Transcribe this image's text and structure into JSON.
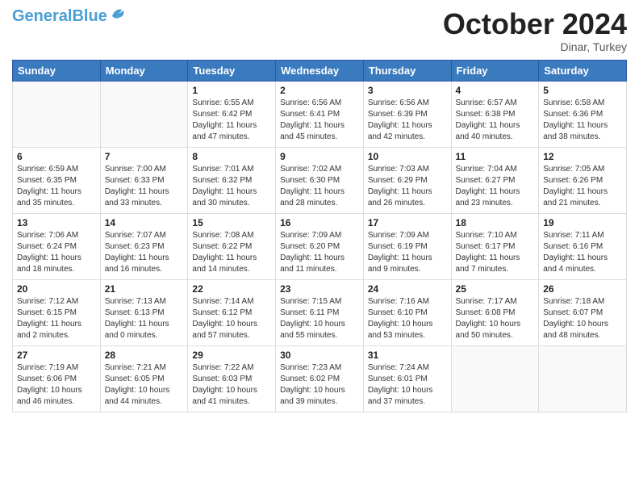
{
  "header": {
    "logo_general": "General",
    "logo_blue": "Blue",
    "month_title": "October 2024",
    "subtitle": "Dinar, Turkey"
  },
  "weekdays": [
    "Sunday",
    "Monday",
    "Tuesday",
    "Wednesday",
    "Thursday",
    "Friday",
    "Saturday"
  ],
  "weeks": [
    [
      {
        "day": "",
        "sunrise": "",
        "sunset": "",
        "daylight": ""
      },
      {
        "day": "",
        "sunrise": "",
        "sunset": "",
        "daylight": ""
      },
      {
        "day": "1",
        "sunrise": "Sunrise: 6:55 AM",
        "sunset": "Sunset: 6:42 PM",
        "daylight": "Daylight: 11 hours and 47 minutes."
      },
      {
        "day": "2",
        "sunrise": "Sunrise: 6:56 AM",
        "sunset": "Sunset: 6:41 PM",
        "daylight": "Daylight: 11 hours and 45 minutes."
      },
      {
        "day": "3",
        "sunrise": "Sunrise: 6:56 AM",
        "sunset": "Sunset: 6:39 PM",
        "daylight": "Daylight: 11 hours and 42 minutes."
      },
      {
        "day": "4",
        "sunrise": "Sunrise: 6:57 AM",
        "sunset": "Sunset: 6:38 PM",
        "daylight": "Daylight: 11 hours and 40 minutes."
      },
      {
        "day": "5",
        "sunrise": "Sunrise: 6:58 AM",
        "sunset": "Sunset: 6:36 PM",
        "daylight": "Daylight: 11 hours and 38 minutes."
      }
    ],
    [
      {
        "day": "6",
        "sunrise": "Sunrise: 6:59 AM",
        "sunset": "Sunset: 6:35 PM",
        "daylight": "Daylight: 11 hours and 35 minutes."
      },
      {
        "day": "7",
        "sunrise": "Sunrise: 7:00 AM",
        "sunset": "Sunset: 6:33 PM",
        "daylight": "Daylight: 11 hours and 33 minutes."
      },
      {
        "day": "8",
        "sunrise": "Sunrise: 7:01 AM",
        "sunset": "Sunset: 6:32 PM",
        "daylight": "Daylight: 11 hours and 30 minutes."
      },
      {
        "day": "9",
        "sunrise": "Sunrise: 7:02 AM",
        "sunset": "Sunset: 6:30 PM",
        "daylight": "Daylight: 11 hours and 28 minutes."
      },
      {
        "day": "10",
        "sunrise": "Sunrise: 7:03 AM",
        "sunset": "Sunset: 6:29 PM",
        "daylight": "Daylight: 11 hours and 26 minutes."
      },
      {
        "day": "11",
        "sunrise": "Sunrise: 7:04 AM",
        "sunset": "Sunset: 6:27 PM",
        "daylight": "Daylight: 11 hours and 23 minutes."
      },
      {
        "day": "12",
        "sunrise": "Sunrise: 7:05 AM",
        "sunset": "Sunset: 6:26 PM",
        "daylight": "Daylight: 11 hours and 21 minutes."
      }
    ],
    [
      {
        "day": "13",
        "sunrise": "Sunrise: 7:06 AM",
        "sunset": "Sunset: 6:24 PM",
        "daylight": "Daylight: 11 hours and 18 minutes."
      },
      {
        "day": "14",
        "sunrise": "Sunrise: 7:07 AM",
        "sunset": "Sunset: 6:23 PM",
        "daylight": "Daylight: 11 hours and 16 minutes."
      },
      {
        "day": "15",
        "sunrise": "Sunrise: 7:08 AM",
        "sunset": "Sunset: 6:22 PM",
        "daylight": "Daylight: 11 hours and 14 minutes."
      },
      {
        "day": "16",
        "sunrise": "Sunrise: 7:09 AM",
        "sunset": "Sunset: 6:20 PM",
        "daylight": "Daylight: 11 hours and 11 minutes."
      },
      {
        "day": "17",
        "sunrise": "Sunrise: 7:09 AM",
        "sunset": "Sunset: 6:19 PM",
        "daylight": "Daylight: 11 hours and 9 minutes."
      },
      {
        "day": "18",
        "sunrise": "Sunrise: 7:10 AM",
        "sunset": "Sunset: 6:17 PM",
        "daylight": "Daylight: 11 hours and 7 minutes."
      },
      {
        "day": "19",
        "sunrise": "Sunrise: 7:11 AM",
        "sunset": "Sunset: 6:16 PM",
        "daylight": "Daylight: 11 hours and 4 minutes."
      }
    ],
    [
      {
        "day": "20",
        "sunrise": "Sunrise: 7:12 AM",
        "sunset": "Sunset: 6:15 PM",
        "daylight": "Daylight: 11 hours and 2 minutes."
      },
      {
        "day": "21",
        "sunrise": "Sunrise: 7:13 AM",
        "sunset": "Sunset: 6:13 PM",
        "daylight": "Daylight: 11 hours and 0 minutes."
      },
      {
        "day": "22",
        "sunrise": "Sunrise: 7:14 AM",
        "sunset": "Sunset: 6:12 PM",
        "daylight": "Daylight: 10 hours and 57 minutes."
      },
      {
        "day": "23",
        "sunrise": "Sunrise: 7:15 AM",
        "sunset": "Sunset: 6:11 PM",
        "daylight": "Daylight: 10 hours and 55 minutes."
      },
      {
        "day": "24",
        "sunrise": "Sunrise: 7:16 AM",
        "sunset": "Sunset: 6:10 PM",
        "daylight": "Daylight: 10 hours and 53 minutes."
      },
      {
        "day": "25",
        "sunrise": "Sunrise: 7:17 AM",
        "sunset": "Sunset: 6:08 PM",
        "daylight": "Daylight: 10 hours and 50 minutes."
      },
      {
        "day": "26",
        "sunrise": "Sunrise: 7:18 AM",
        "sunset": "Sunset: 6:07 PM",
        "daylight": "Daylight: 10 hours and 48 minutes."
      }
    ],
    [
      {
        "day": "27",
        "sunrise": "Sunrise: 7:19 AM",
        "sunset": "Sunset: 6:06 PM",
        "daylight": "Daylight: 10 hours and 46 minutes."
      },
      {
        "day": "28",
        "sunrise": "Sunrise: 7:21 AM",
        "sunset": "Sunset: 6:05 PM",
        "daylight": "Daylight: 10 hours and 44 minutes."
      },
      {
        "day": "29",
        "sunrise": "Sunrise: 7:22 AM",
        "sunset": "Sunset: 6:03 PM",
        "daylight": "Daylight: 10 hours and 41 minutes."
      },
      {
        "day": "30",
        "sunrise": "Sunrise: 7:23 AM",
        "sunset": "Sunset: 6:02 PM",
        "daylight": "Daylight: 10 hours and 39 minutes."
      },
      {
        "day": "31",
        "sunrise": "Sunrise: 7:24 AM",
        "sunset": "Sunset: 6:01 PM",
        "daylight": "Daylight: 10 hours and 37 minutes."
      },
      {
        "day": "",
        "sunrise": "",
        "sunset": "",
        "daylight": ""
      },
      {
        "day": "",
        "sunrise": "",
        "sunset": "",
        "daylight": ""
      }
    ]
  ]
}
